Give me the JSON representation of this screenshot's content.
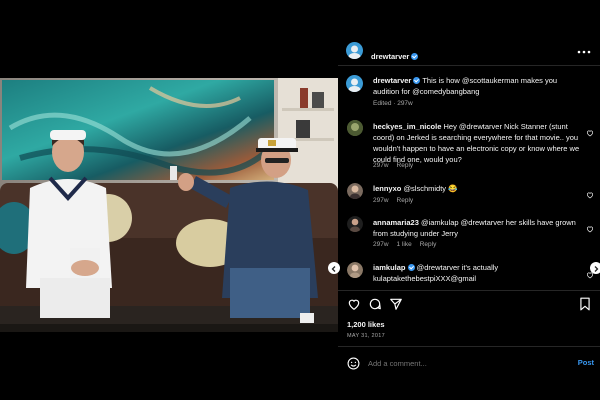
{
  "post": {
    "author": "drewtarver",
    "more_icon": "more-horizontal-icon",
    "caption_author": "drewtarver",
    "caption_text": "This is how @scottaukerman makes you audition for @comedybangbang",
    "caption_meta": "Edited · 297w"
  },
  "comments": [
    {
      "user": "heckyes_im_nicole",
      "text": "Hey @drewtarver Nick Stanner (stunt coord) on Jerked is searching everywhere for that movie.. you wouldn't happen to have an electronic copy or know where we could find one, would you?",
      "age": "297w",
      "reply": "Reply",
      "likes": ""
    },
    {
      "user": "lennyxo",
      "text": "@slschmidty 😂",
      "age": "297w",
      "reply": "Reply",
      "likes": ""
    },
    {
      "user": "annamaria23",
      "text": "@iamkulap @drewtarver her skills have grown from studying under Jerry",
      "age": "297w",
      "reply": "Reply",
      "likes": "1 like"
    },
    {
      "user": "iamkulap",
      "text": "@drewtarver it's actually kulaptakethebestpiXXX@gmail",
      "age": "",
      "reply": "",
      "likes": ""
    }
  ],
  "actions": {
    "like_icon": "heart-icon",
    "comment_icon": "comment-icon",
    "share_icon": "send-icon",
    "save_icon": "bookmark-icon",
    "likes_count": "1,200 likes",
    "date": "MAY 31, 2017"
  },
  "composer": {
    "emoji_icon": "emoji-icon",
    "placeholder": "Add a comment...",
    "post_label": "Post"
  },
  "colors": {
    "accent": "#3897f0",
    "background": "#000000",
    "muted": "#a8a8a8"
  }
}
